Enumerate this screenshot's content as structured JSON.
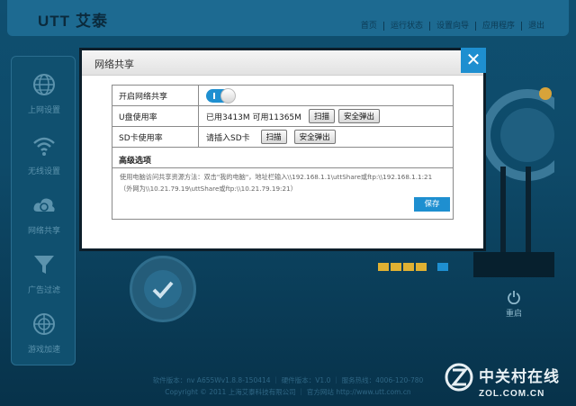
{
  "app": {
    "logo_text": "UTT",
    "logo_cn": "艾泰",
    "nav": [
      "首页",
      "运行状态",
      "设置向导",
      "应用程序",
      "退出"
    ]
  },
  "sidebar": {
    "items": [
      {
        "label": "上网设置",
        "icon": "globe-icon"
      },
      {
        "label": "无线设置",
        "icon": "wifi-icon"
      },
      {
        "label": "网络共享",
        "icon": "cloud-share-icon"
      },
      {
        "label": "广告过滤",
        "icon": "funnel-icon"
      },
      {
        "label": "游戏加速",
        "icon": "globe-speed-icon"
      }
    ]
  },
  "device": {
    "reboot_label": "重启"
  },
  "footer": {
    "line1": "软件版本：nv A655Wv1.8.8-150414 ｜ 硬件版本：V1.0 ｜ 服务热线：4006-120-780",
    "line2": "Copyright © 2011 上海艾泰科技有限公司 ｜ 官方网站 http://www.utt.com.cn"
  },
  "watermark": {
    "cn": "中关村在线",
    "en": "ZOL.COM.CN"
  },
  "modal": {
    "title": "网络共享",
    "close_glyph": "✕",
    "rows": {
      "share_label": "开启网络共享",
      "share_enabled": true,
      "usb_label": "U盘使用率",
      "usb_usage": "已用3413M 可用11365M",
      "sd_label": "SD卡使用率",
      "sd_usage": "请插入SD卡"
    },
    "scan_label": "扫描",
    "eject_label": "安全弹出",
    "advanced_title": "高级选项",
    "help_line1": "使用电脑访问共享资源方法：双击\"我的电脑\"，地址栏输入\\\\192.168.1.1\\uttShare或ftp:\\\\192.168.1.1:21",
    "help_line2": "（外网为\\\\10.21.79.19\\uttShare或ftp:\\\\10.21.79.19:21）",
    "save_label": "保存"
  },
  "colors": {
    "accent": "#1e8fd0",
    "background": "#0e4a69"
  }
}
